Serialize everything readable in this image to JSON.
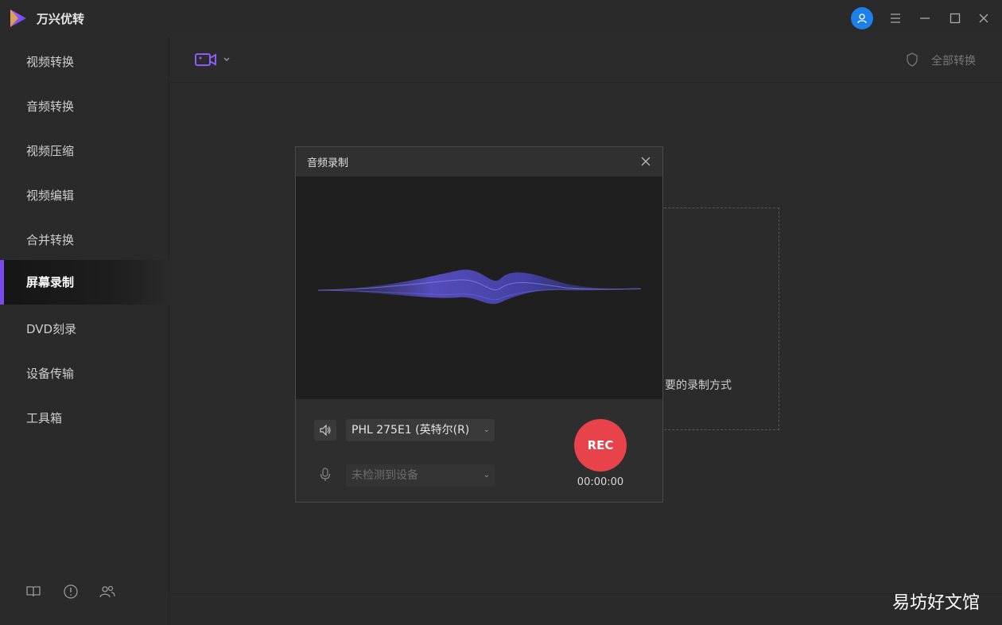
{
  "app": {
    "title": "万兴优转"
  },
  "sidebar": {
    "items": [
      {
        "label": "视频转换"
      },
      {
        "label": "音频转换"
      },
      {
        "label": "视频压缩"
      },
      {
        "label": "视频编辑"
      },
      {
        "label": "合并转换"
      },
      {
        "label": "屏幕录制"
      },
      {
        "label": "DVD刻录"
      },
      {
        "label": "设备传输"
      },
      {
        "label": "工具箱"
      }
    ],
    "active_index": 5
  },
  "toolbar": {
    "right_label": "全部转换"
  },
  "main": {
    "hint": "要的录制方式"
  },
  "dialog": {
    "title": "音频录制",
    "speaker_device": "PHL 275E1 (英特尔(R)",
    "mic_device": "未检测到设备",
    "rec_label": "REC",
    "timer": "00:00:00"
  },
  "watermark": "易坊好文馆",
  "colors": {
    "accent": "#7a4cf0",
    "rec": "#e8424a",
    "avatar": "#1d7fe8"
  }
}
